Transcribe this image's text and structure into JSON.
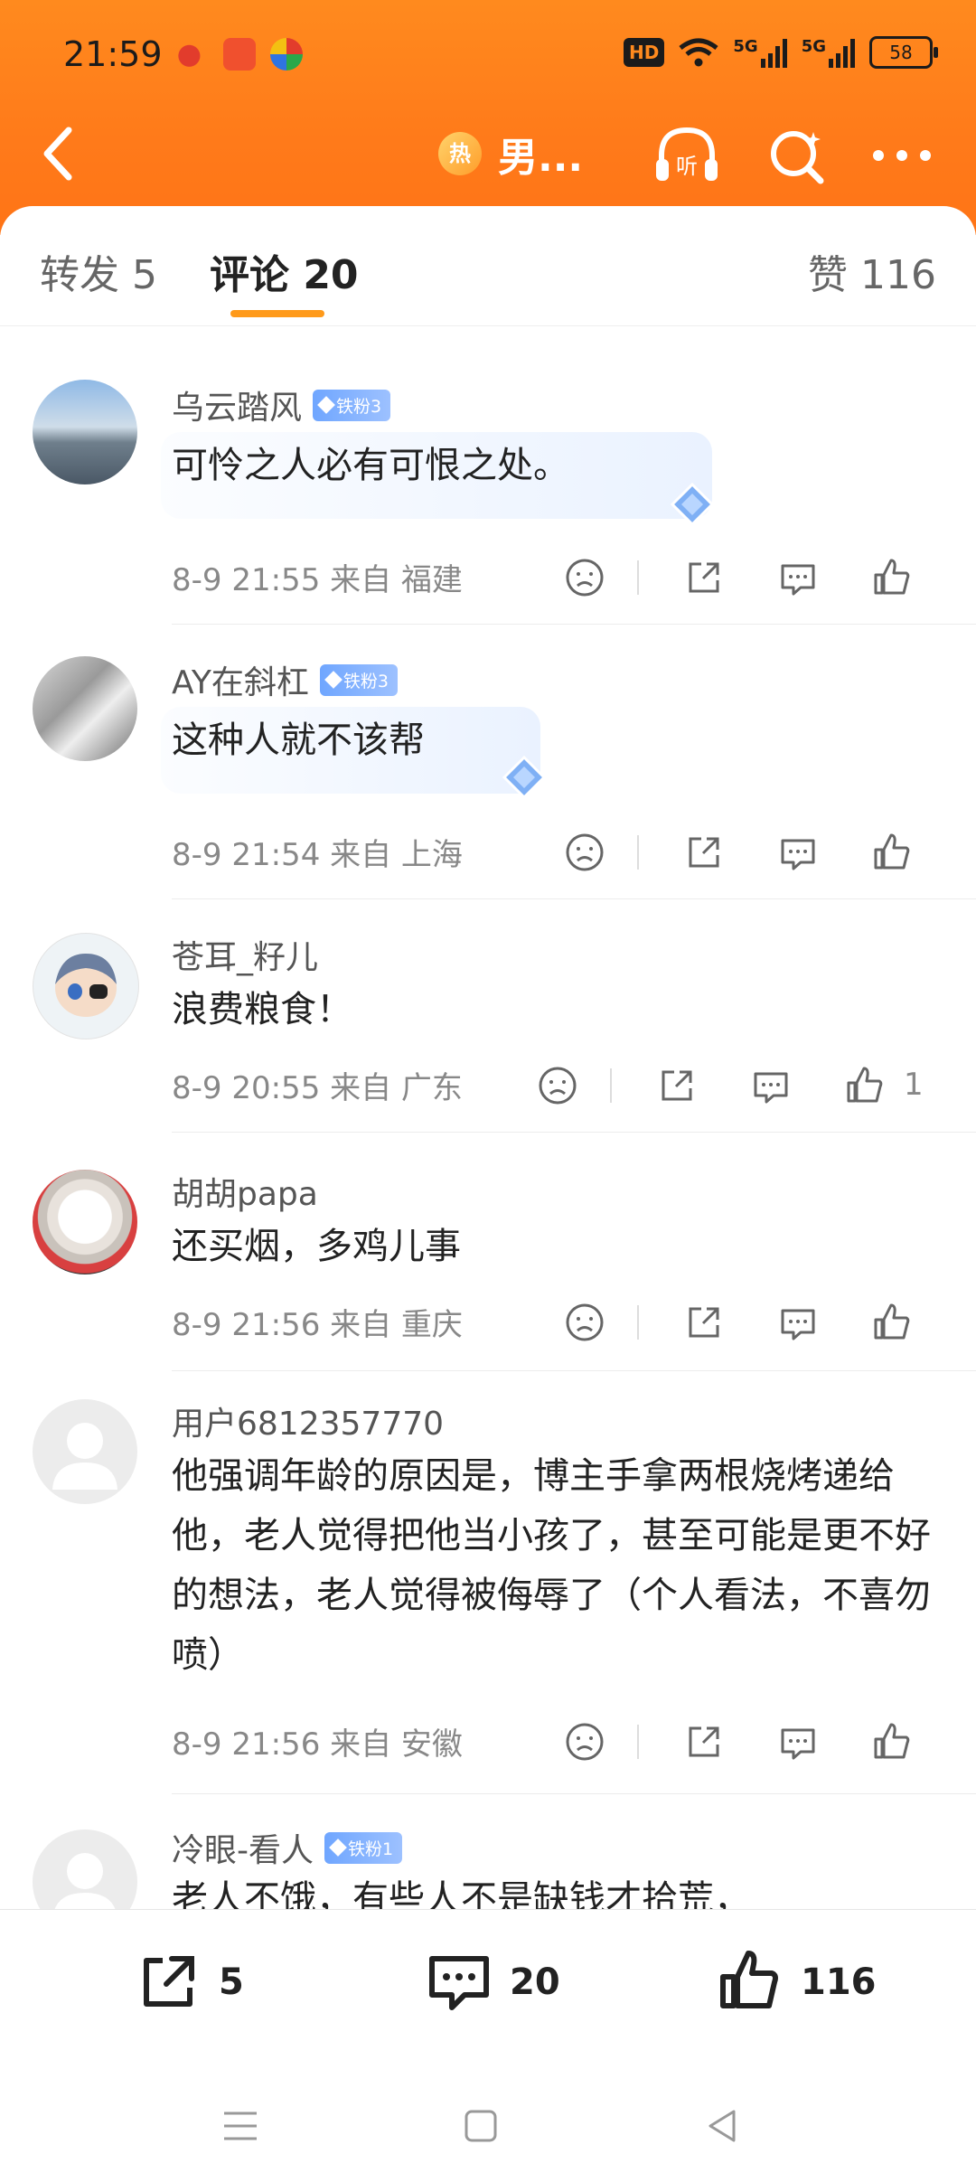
{
  "status": {
    "time": "21:59",
    "hd": "HD",
    "net1": "5G",
    "net2": "5G",
    "battery": "58"
  },
  "nav": {
    "hot_label": "热",
    "title": "男..."
  },
  "tabs": {
    "repost": "转发 5",
    "comment": "评论 20",
    "like": "赞 116"
  },
  "comments": [
    {
      "user": "乌云踏风",
      "badge": "铁粉3",
      "text": "可怜之人必有可恨之处。",
      "meta": "8-9 21:55 来自 福建",
      "likes": ""
    },
    {
      "user": "AY在斜杠",
      "badge": "铁粉3",
      "text": "这种人就不该帮",
      "meta": "8-9 21:54 来自 上海",
      "likes": ""
    },
    {
      "user": "苍耳_籽儿",
      "badge": "",
      "text": "浪费粮食！",
      "meta": "8-9 20:55 来自 广东",
      "likes": "1"
    },
    {
      "user": "胡胡papa",
      "badge": "",
      "text": "还买烟，多鸡儿事",
      "meta": "8-9 21:56 来自 重庆",
      "likes": ""
    },
    {
      "user": "用户6812357770",
      "badge": "",
      "text": "他强调年龄的原因是，博主手拿两根烧烤递给他，老人觉得把他当小孩了，甚至可能是更不好的想法，老人觉得被侮辱了（个人看法，不喜勿喷）",
      "meta": "8-9 21:56 来自 安徽",
      "likes": ""
    },
    {
      "user": "冷眼-看人",
      "badge": "铁粉1",
      "text": "老人不饿，有些人不是缺钱才拾荒，",
      "meta": "",
      "likes": ""
    }
  ],
  "bottom": {
    "repost_count": "5",
    "comment_count": "20",
    "like_count": "116"
  },
  "colors": {
    "header": "#ff7a1a",
    "accent": "#ff9a1a",
    "badge": "#7aaeff"
  }
}
